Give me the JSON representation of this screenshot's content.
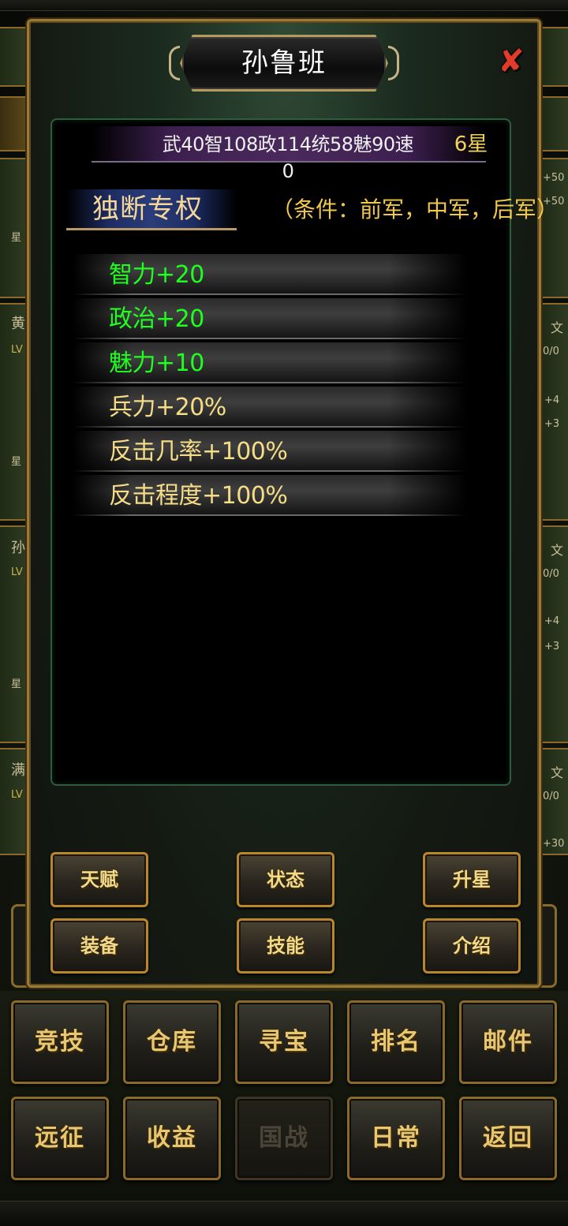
{
  "dialog": {
    "title": "孙鲁班",
    "close_icon": "close-x-icon",
    "stats": "武40智108政114统58魅90速0",
    "stars": "6星",
    "skill": {
      "name": "独断专权",
      "condition": "（条件：前军，中军，后军）"
    },
    "bonuses": [
      {
        "text": "智力+20",
        "color": "#1fff1f"
      },
      {
        "text": "政治+20",
        "color": "#1fff1f"
      },
      {
        "text": "魅力+10",
        "color": "#1fff1f"
      },
      {
        "text": "兵力+20%",
        "color": "#f5dc86"
      },
      {
        "text": "反击几率+100%",
        "color": "#f5dc86"
      },
      {
        "text": "反击程度+100%",
        "color": "#f5dc86"
      }
    ],
    "buttons": {
      "talent": "天赋",
      "status": "状态",
      "star_up": "升星",
      "equipment": "装备",
      "skills": "技能",
      "intro": "介绍"
    }
  },
  "background_list": {
    "left_names": [
      "黄",
      "孙",
      "满"
    ],
    "left_labels": {
      "lv": "LV",
      "star": "星"
    },
    "right_texts": [
      "+50",
      "+50",
      "文",
      "0/0",
      "+4",
      "+3",
      "文",
      "0/0",
      "+4",
      "+3",
      "文",
      "0/0",
      "+30"
    ]
  },
  "bottom_menu": {
    "row1": [
      "竞技",
      "仓库",
      "寻宝",
      "排名",
      "邮件"
    ],
    "row2": [
      "远征",
      "收益",
      "国战",
      "日常",
      "返回"
    ]
  },
  "colors": {
    "frame_gold": "#9c7a34",
    "green_bonus": "#1fff1f",
    "gold_bonus": "#f5dc86",
    "star_yellow": "#f2d35a",
    "close_red": "#e23b2a"
  }
}
